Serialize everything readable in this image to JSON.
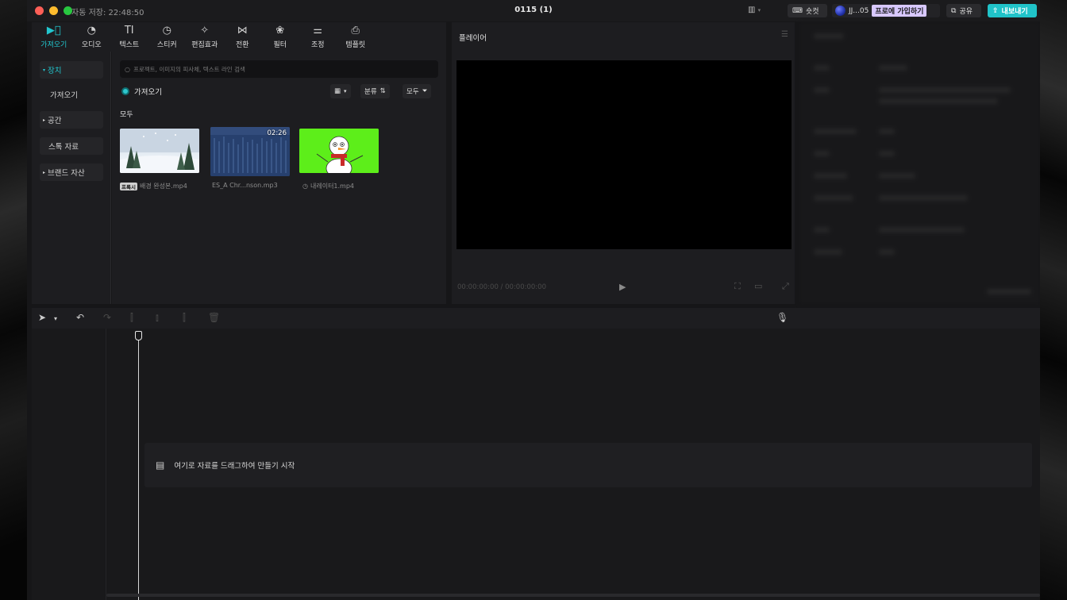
{
  "window": {
    "autosave": "자동 저장: 22:48:50",
    "title": "0115 (1)",
    "shortcut": "숏컷",
    "user": "JJ...05",
    "pro": "프로에 가입하기",
    "share": "공유",
    "export": "내보내기"
  },
  "tools": [
    {
      "label": "가져오기",
      "icon": "import-icon"
    },
    {
      "label": "오디오",
      "icon": "audio-icon"
    },
    {
      "label": "텍스트",
      "icon": "text-icon"
    },
    {
      "label": "스티커",
      "icon": "sticker-icon"
    },
    {
      "label": "편집효과",
      "icon": "effects-icon"
    },
    {
      "label": "전환",
      "icon": "transition-icon"
    },
    {
      "label": "필터",
      "icon": "filter-icon"
    },
    {
      "label": "조정",
      "icon": "adjust-icon"
    },
    {
      "label": "템플릿",
      "icon": "template-icon"
    }
  ],
  "sidebar": {
    "items": [
      "장치",
      "가져오기",
      "공간",
      "스톡 자료",
      "브랜드 자산"
    ]
  },
  "media": {
    "search_placeholder": "프로젝트, 이미지의 피사체, 텍스트 라인 검색",
    "import_label": "가져오기",
    "sort_label": "분류",
    "filter_label": "모두",
    "section": "모두",
    "items": [
      {
        "name": "배경 완성본.mp4",
        "tag": "프록시",
        "duration": ""
      },
      {
        "name": "ES_A Chr...nson.mp3",
        "tag": "",
        "duration": "02:26"
      },
      {
        "name": "내레이터1.mp4",
        "tag": "",
        "duration": ""
      }
    ]
  },
  "player": {
    "title": "플레이어",
    "timecode": "00:00:00:00 / 00:00:00:00"
  },
  "timeline": {
    "drop_hint": "여기로 자료를 드래그하여 만들기 시작"
  },
  "colors": {
    "accent": "#22c7cf",
    "export": "#20c3c9",
    "pro_badge": "#d8c8ff"
  }
}
